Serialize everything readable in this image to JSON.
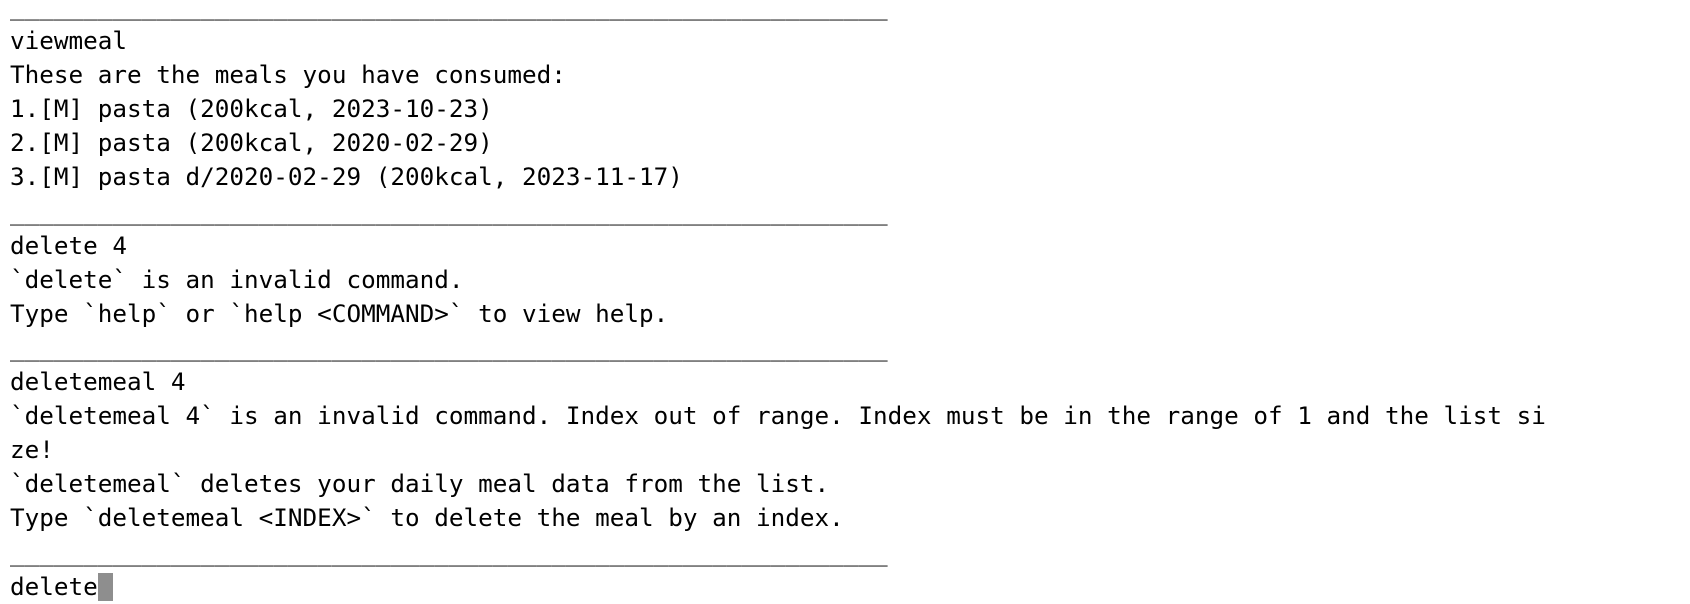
{
  "separator": "____________________________________________________________",
  "blocks": [
    {
      "command": "viewmeal",
      "output": [
        "These are the meals you have consumed:",
        "1.[M] pasta (200kcal, 2023-10-23)",
        "2.[M] pasta (200kcal, 2020-02-29)",
        "3.[M] pasta d/2020-02-29 (200kcal, 2023-11-17)"
      ]
    },
    {
      "command": "delete 4",
      "output": [
        "`delete` is an invalid command.",
        "Type `help` or `help <COMMAND>` to view help."
      ]
    },
    {
      "command": "deletemeal 4",
      "output": [
        "`deletemeal 4` is an invalid command. Index out of range. Index must be in the range of 1 and the list si",
        "ze!",
        "`deletemeal` deletes your daily meal data from the list.",
        "Type `deletemeal <INDEX>` to delete the meal by an index."
      ]
    }
  ],
  "current_input": "delete"
}
